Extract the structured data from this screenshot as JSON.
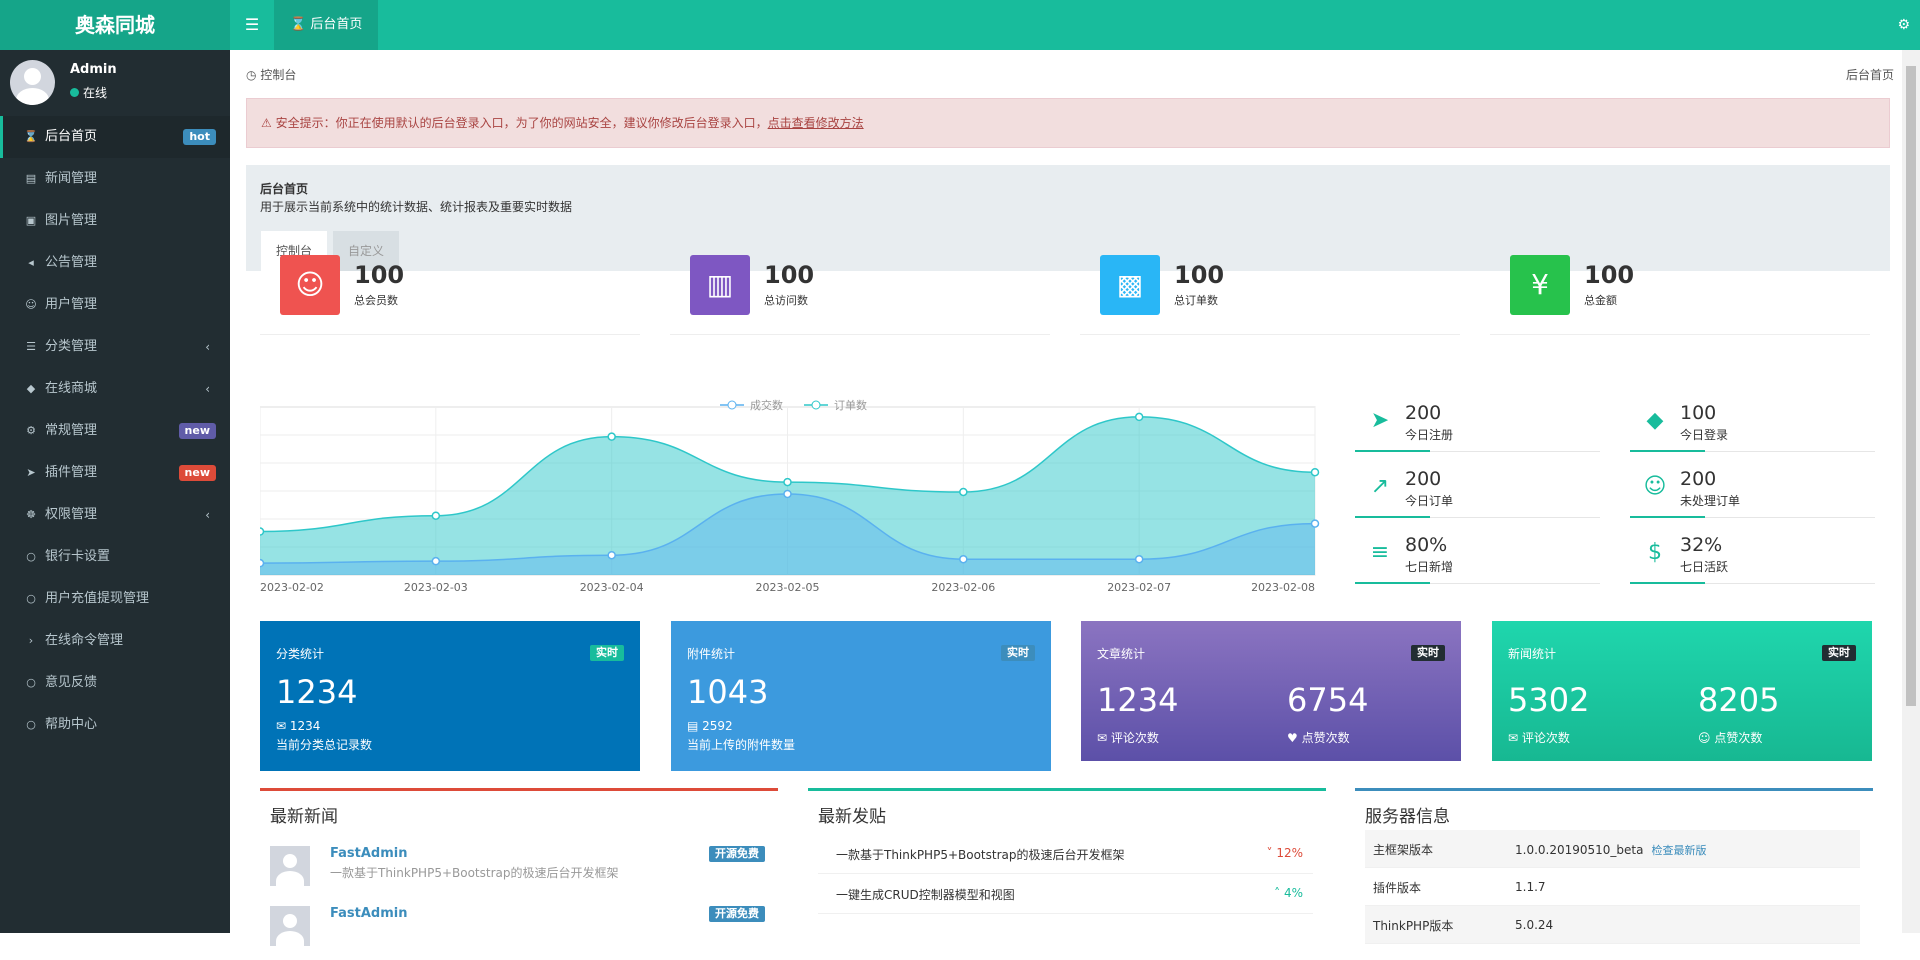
{
  "brand": "奥森同城",
  "topbar": {
    "tab_label": "后台首页",
    "tab_icon": "hourglass-icon",
    "toggle_icon": "hamburger-icon",
    "right_icon": "gears-icon"
  },
  "user": {
    "name": "Admin",
    "status": "在线"
  },
  "sidebar": {
    "items": [
      {
        "label": "后台首页",
        "icon": "hourglass-icon",
        "badge": "hot",
        "badge_color": "#3c8dbc"
      },
      {
        "label": "新闻管理",
        "icon": "newspaper-icon"
      },
      {
        "label": "图片管理",
        "icon": "image-icon"
      },
      {
        "label": "公告管理",
        "icon": "volume-icon"
      },
      {
        "label": "用户管理",
        "icon": "users-icon"
      },
      {
        "label": "分类管理",
        "icon": "list-icon",
        "arrow": "‹"
      },
      {
        "label": "在线商城",
        "icon": "cart-icon",
        "arrow": "‹"
      },
      {
        "label": "常规管理",
        "icon": "cogs-icon",
        "badge": "new",
        "badge_color": "#605ca8"
      },
      {
        "label": "插件管理",
        "icon": "rocket-icon",
        "badge": "new",
        "badge_color": "#dd4b39"
      },
      {
        "label": "权限管理",
        "icon": "group-icon",
        "arrow": "‹"
      },
      {
        "label": "银行卡设置",
        "icon": "circle-icon"
      },
      {
        "label": "用户充值提现管理",
        "icon": "circle-icon"
      },
      {
        "label": "在线命令管理",
        "icon": "terminal-icon"
      },
      {
        "label": "意见反馈",
        "icon": "circle-icon"
      },
      {
        "label": "帮助中心",
        "icon": "circle-icon"
      }
    ]
  },
  "breadcrumb": {
    "left": "控制台",
    "right": "后台首页"
  },
  "alert": {
    "text": "安全提示：你正在使用默认的后台登录入口，为了你的网站安全，建议你修改后台登录入口，",
    "link": "点击查看修改方法"
  },
  "panel": {
    "title": "后台首页",
    "desc": "用于展示当前系统中的统计数据、统计报表及重要实时数据",
    "tabs": [
      "控制台",
      "自定义"
    ]
  },
  "stats": [
    {
      "value": "100",
      "label": "总会员数",
      "color": "#ef5350",
      "icon": "users-icon"
    },
    {
      "value": "100",
      "label": "总访问数",
      "color": "#7e57c2",
      "icon": "book-icon"
    },
    {
      "value": "100",
      "label": "总订单数",
      "color": "#29b6f6",
      "icon": "shopping-bag-icon"
    },
    {
      "value": "100",
      "label": "总金额",
      "color": "#27c24c",
      "icon": "yen-icon"
    }
  ],
  "chart_data": {
    "type": "area",
    "categories": [
      "2023-02-02",
      "2023-02-03",
      "2023-02-04",
      "2023-02-05",
      "2023-02-06",
      "2023-02-07",
      "2023-02-08"
    ],
    "series": [
      {
        "name": "成交数",
        "values": [
          6,
          7,
          10,
          41,
          8,
          8,
          26
        ],
        "color": "#5ab1ef"
      },
      {
        "name": "订单数",
        "values": [
          22,
          30,
          70,
          47,
          42,
          80,
          52
        ],
        "color": "#2ec7c9"
      }
    ],
    "ylim": [
      0,
      85
    ],
    "legend_position": "top-center",
    "grid": true
  },
  "mini_stats": [
    {
      "value": "200",
      "label": "今日注册",
      "icon": "rocket-icon"
    },
    {
      "value": "100",
      "label": "今日登录",
      "icon": "cart-icon"
    },
    {
      "value": "200",
      "label": "今日订单",
      "icon": "line-chart-icon"
    },
    {
      "value": "200",
      "label": "未处理订单",
      "icon": "users-icon"
    },
    {
      "value": "80%",
      "label": "七日新增",
      "icon": "list-alt-icon"
    },
    {
      "value": "32%",
      "label": "七日活跃",
      "icon": "dollar-icon"
    }
  ],
  "cards": [
    {
      "title": "分类统计",
      "badge": "实时",
      "value": "1234",
      "sub": "1234",
      "desc": "当前分类总记录数",
      "bg": "#0073b7",
      "badge_bg": "#18bc9c"
    },
    {
      "title": "附件统计",
      "badge": "实时",
      "value": "1043",
      "sub": "2592",
      "desc": "当前上传的附件数量",
      "bg": "#3c9ade",
      "badge_bg": "#3c8dbc"
    },
    {
      "title": "文章统计",
      "badge": "实时",
      "value1": "1234",
      "label1": "评论次数",
      "value2": "6754",
      "label2": "点赞次数",
      "bg": "#6a5fb0",
      "badge_bg": "#222d32"
    },
    {
      "title": "新闻统计",
      "badge": "实时",
      "value1": "5302",
      "label1": "评论次数",
      "value2": "8205",
      "label2": "点赞次数",
      "bg": "#1bc49e",
      "badge_bg": "#222d32"
    }
  ],
  "latest_news": {
    "title": "最新新闻",
    "items": [
      {
        "title": "FastAdmin",
        "desc": "一款基于ThinkPHP5+Bootstrap的极速后台开发框架",
        "badge": "开源免费"
      },
      {
        "title": "FastAdmin",
        "badge": "开源免费"
      }
    ]
  },
  "latest_posts": {
    "title": "最新发贴",
    "items": [
      {
        "title": "一款基于ThinkPHP5+Bootstrap的极速后台开发框架",
        "pct": "12%",
        "dir": "down",
        "color": "#dd4b39"
      },
      {
        "title": "一键生成CRUD控制器模型和视图",
        "pct": "4%",
        "dir": "up",
        "color": "#18bc9c"
      }
    ]
  },
  "server_info": {
    "title": "服务器信息",
    "rows": [
      {
        "key": "主框架版本",
        "value": "1.0.0.20190510_beta",
        "action": "检查最新版"
      },
      {
        "key": "插件版本",
        "value": "1.1.7"
      },
      {
        "key": "ThinkPHP版本",
        "value": "5.0.24"
      }
    ]
  }
}
